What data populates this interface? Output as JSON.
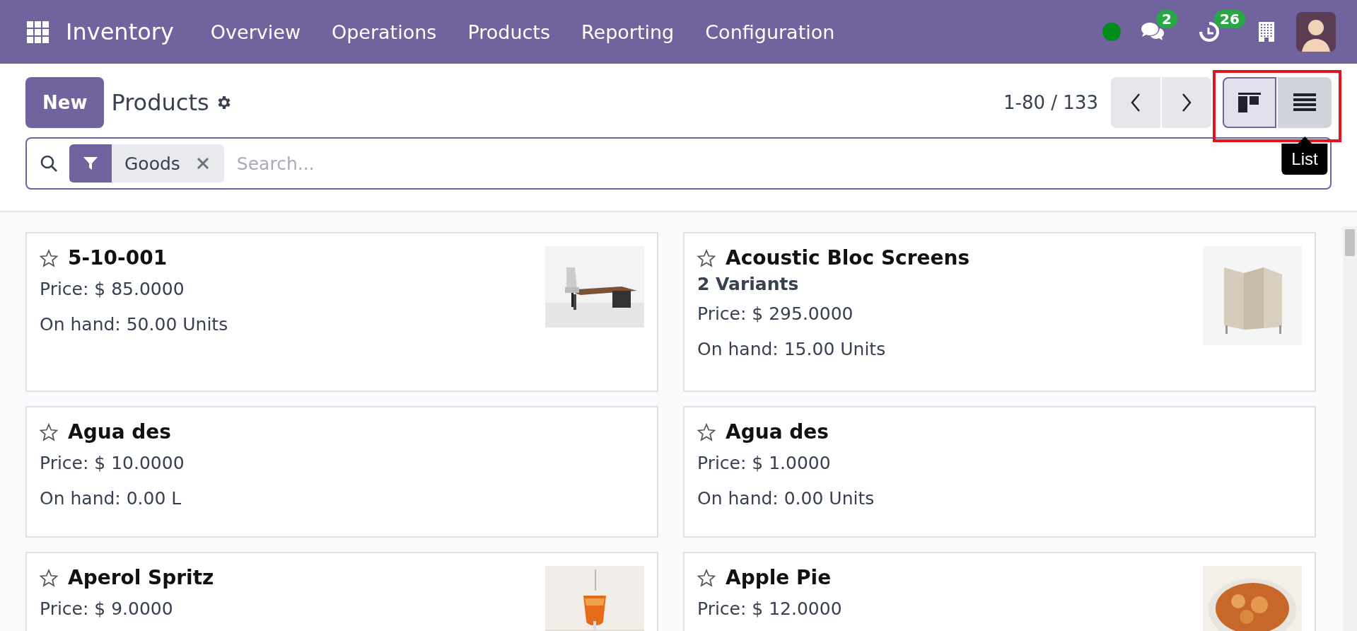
{
  "navbar": {
    "app": "Inventory",
    "menu": [
      "Overview",
      "Operations",
      "Products",
      "Reporting",
      "Configuration"
    ],
    "online": true,
    "messages_badge": "2",
    "activities_badge": "26"
  },
  "control_panel": {
    "new_button": "New",
    "title": "Products",
    "pager": "1-80 / 133",
    "views": [
      {
        "kind": "kanban",
        "selected": true
      },
      {
        "kind": "list",
        "selected": false,
        "tooltip": "List"
      }
    ]
  },
  "search": {
    "facet": "Goods",
    "placeholder": "Search..."
  },
  "products": [
    {
      "name": "5-10-001",
      "favorite": false,
      "price": "Price: $ 85.0000",
      "on_hand": "On hand: 50.00 Units",
      "picture": true
    },
    {
      "name": "Acoustic Bloc Screens",
      "favorite": false,
      "variants": "2 Variants",
      "price": "Price: $ 295.0000",
      "on_hand": "On hand: 15.00 Units",
      "picture": true
    },
    {
      "name": "Agua des",
      "favorite": false,
      "price": "Price: $ 10.0000",
      "on_hand": "On hand: 0.00 L",
      "picture": false
    },
    {
      "name": "Agua des",
      "favorite": false,
      "price": "Price: $ 1.0000",
      "on_hand": "On hand: 0.00 Units",
      "picture": false
    },
    {
      "name": "Aperol Spritz",
      "favorite": false,
      "price": "Price: $ 9.0000",
      "picture": true
    },
    {
      "name": "Apple Pie",
      "favorite": false,
      "price": "Price: $ 12.0000",
      "picture": true
    }
  ]
}
